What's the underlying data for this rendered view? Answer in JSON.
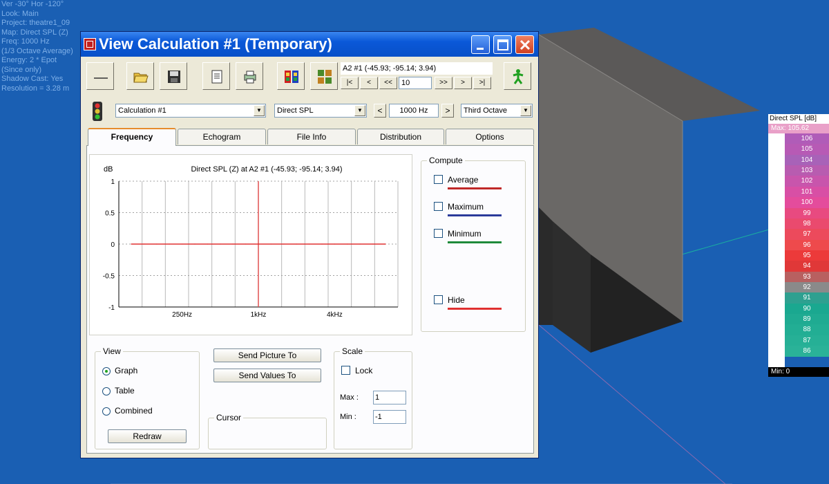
{
  "overlay": {
    "lines": [
      "Ver -30°  Hor -120°",
      "Look: Main",
      "Project: theatre1_09",
      "Map: Direct SPL (Z)",
      "Freq: 1000 Hz",
      "(1/3 Octave Average)",
      "Energy: 2 * Epot",
      "(Since only)",
      "Shadow Cast: Yes",
      "Resolution =   3.28 m"
    ]
  },
  "legend": {
    "title": "Direct SPL [dB]",
    "max_label": "Max: 105.62",
    "min_label": "Min: 0",
    "items": [
      {
        "value": "106",
        "color": "#b05cb8"
      },
      {
        "value": "105",
        "color": "#b75ab5"
      },
      {
        "value": "104",
        "color": "#a862b8"
      },
      {
        "value": "103",
        "color": "#b85cb0"
      },
      {
        "value": "102",
        "color": "#c855ac"
      },
      {
        "value": "101",
        "color": "#d84fa5"
      },
      {
        "value": "100",
        "color": "#e44c9c"
      },
      {
        "value": "99",
        "color": "#e84a80"
      },
      {
        "value": "98",
        "color": "#ea4a6e"
      },
      {
        "value": "97",
        "color": "#ec4a5c"
      },
      {
        "value": "96",
        "color": "#ee4a4c"
      },
      {
        "value": "95",
        "color": "#ec3a3a"
      },
      {
        "value": "94",
        "color": "#e03838"
      },
      {
        "value": "93",
        "color": "#b86060"
      },
      {
        "value": "92",
        "color": "#8a8a8a"
      },
      {
        "value": "91",
        "color": "#2ea090"
      },
      {
        "value": "90",
        "color": "#1aa890"
      },
      {
        "value": "89",
        "color": "#1fab92"
      },
      {
        "value": "88",
        "color": "#22ae94"
      },
      {
        "value": "87",
        "color": "#26b096"
      },
      {
        "value": "86",
        "color": "#2ab298"
      }
    ]
  },
  "window": {
    "title": "View Calculation #1 (Temporary)"
  },
  "toolbar": {
    "position_text": "A2 #1  (-45.93; -95.14; 3.94)",
    "nav_first": "|<",
    "nav_prev": "<",
    "nav_prev_step": "<<",
    "step_value": "10",
    "nav_next_step": ">>",
    "nav_next": ">",
    "nav_last": ">|"
  },
  "selectors": {
    "calculation": "Calculation #1",
    "parameter": "Direct SPL",
    "freq_prev": "<",
    "frequency": "1000 Hz",
    "freq_next": ">",
    "band": "Third Octave"
  },
  "tabs": [
    {
      "label": "Frequency",
      "active": true
    },
    {
      "label": "Echogram",
      "active": false
    },
    {
      "label": "File Info",
      "active": false
    },
    {
      "label": "Distribution",
      "active": false
    },
    {
      "label": "Options",
      "active": false
    }
  ],
  "chart_data": {
    "type": "line",
    "title": "Direct SPL (Z) at A2 #1  (-45.93; -95.14; 3.94)",
    "ylabel": "dB",
    "ylim": [
      -1,
      1
    ],
    "yticks": [
      "1",
      "0.5",
      "0",
      "-0.5",
      "-1"
    ],
    "xticks": [
      "250Hz",
      "1kHz",
      "4kHz"
    ],
    "grid": true,
    "cursor_at": "1kHz",
    "series": [
      {
        "color": "#e03030",
        "x": [
          "100Hz",
          "125Hz",
          "160Hz",
          "200Hz",
          "250Hz",
          "315Hz",
          "400Hz",
          "500Hz",
          "630Hz",
          "800Hz",
          "1kHz",
          "1.25kHz",
          "1.6kHz",
          "2kHz",
          "2.5kHz",
          "3.15kHz",
          "4kHz",
          "5kHz",
          "6.3kHz",
          "8kHz",
          "10kHz"
        ],
        "y": [
          0,
          0,
          0,
          0,
          0,
          0,
          0,
          0,
          0,
          0,
          0,
          0,
          0,
          0,
          0,
          0,
          0,
          0,
          0,
          0,
          0
        ]
      }
    ]
  },
  "compute": {
    "legend": "Compute",
    "average": {
      "label": "Average",
      "color": "#c02828"
    },
    "maximum": {
      "label": "Maximum",
      "color": "#2a3a9a"
    },
    "minimum": {
      "label": "Minimum",
      "color": "#1f8a3a"
    },
    "hide": {
      "label": "Hide",
      "color": "#e03030"
    }
  },
  "view": {
    "legend": "View",
    "graph": "Graph",
    "table": "Table",
    "combined": "Combined",
    "selected": "Graph",
    "redraw": "Redraw"
  },
  "actions": {
    "send_picture": "Send Picture To",
    "send_values": "Send Values To"
  },
  "cursor": {
    "legend": "Cursor"
  },
  "scale": {
    "legend": "Scale",
    "lock": "Lock",
    "max_label": "Max :",
    "max_value": "1",
    "min_label": "Min :",
    "min_value": "-1"
  }
}
